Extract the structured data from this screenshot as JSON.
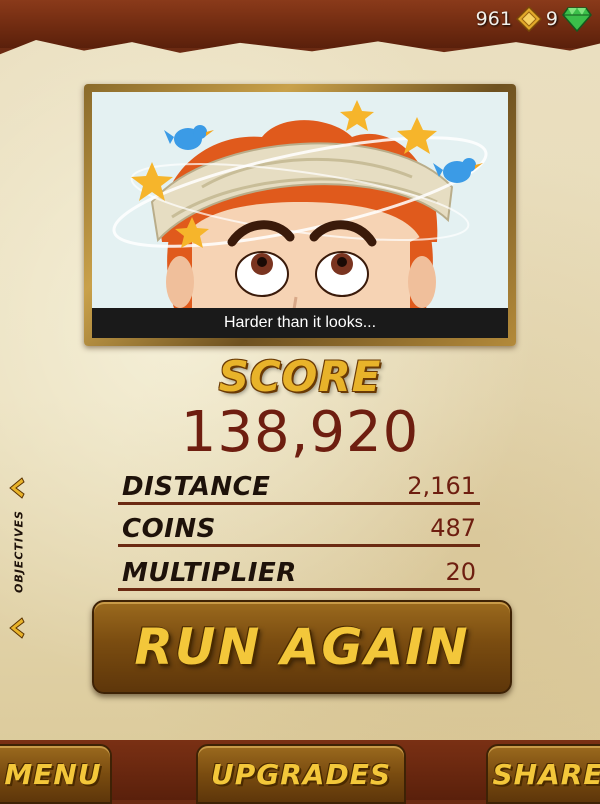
{
  "currency": {
    "coins": "961",
    "gems": "9",
    "coin_icon": "gold-coin-icon",
    "gem_icon": "green-gem-icon"
  },
  "death_screen": {
    "caption": "Harder than it looks...",
    "illustration": "dazed-runner-with-bandaged-head-and-birds"
  },
  "score": {
    "heading": "SCORE",
    "value": "138,920"
  },
  "stats": [
    {
      "label": "DISTANCE",
      "value": "2,161"
    },
    {
      "label": "COINS",
      "value": "487"
    },
    {
      "label": "MULTIPLIER",
      "value": "20"
    }
  ],
  "objectives": {
    "label": "OBJECTIVES",
    "arrow_icon": "chevron-left-icon"
  },
  "buttons": {
    "run_again": "RUN AGAIN",
    "menu": "MENU",
    "upgrades": "UPGRADES",
    "share": "SHARE"
  },
  "colors": {
    "gold_text": "#e8b32a",
    "score_red": "#6e1e10",
    "parchment": "#e8dcb8",
    "leather": "#6b2a12"
  }
}
